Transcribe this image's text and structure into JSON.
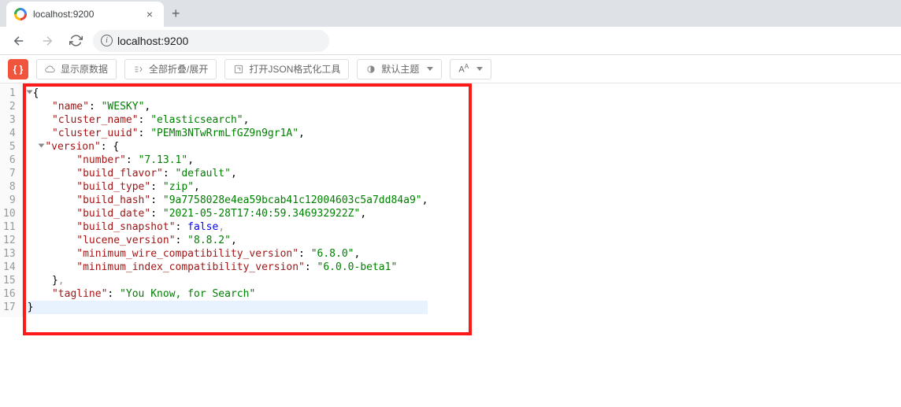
{
  "browser": {
    "tab_title": "localhost:9200",
    "url": "localhost:9200",
    "close_glyph": "×",
    "plus_glyph": "+"
  },
  "toolbar": {
    "badge": "{ }",
    "btn_raw": "显示原数据",
    "btn_collapse": "全部折叠/展开",
    "btn_open_tool": "打开JSON格式化工具",
    "btn_theme": "默认主题",
    "btn_font_base": "A",
    "btn_font_sup": "A"
  },
  "line_numbers": [
    "1",
    "2",
    "3",
    "4",
    "5",
    "6",
    "7",
    "8",
    "9",
    "10",
    "11",
    "12",
    "13",
    "14",
    "15",
    "16",
    "17"
  ],
  "json_response": {
    "name": "WESKY",
    "cluster_name": "elasticsearch",
    "cluster_uuid": "PEMm3NTwRrmLfGZ9n9gr1A",
    "version": {
      "number": "7.13.1",
      "build_flavor": "default",
      "build_type": "zip",
      "build_hash": "9a7758028e4ea59bcab41c12004603c5a7dd84a9",
      "build_date": "2021-05-28T17:40:59.346932922Z",
      "build_snapshot": "false",
      "lucene_version": "8.8.2",
      "minimum_wire_compatibility_version": "6.8.0",
      "minimum_index_compatibility_version": "6.0.0-beta1"
    },
    "tagline": "You Know, for Search"
  },
  "keys": {
    "name": "name",
    "cluster_name": "cluster_name",
    "cluster_uuid": "cluster_uuid",
    "version": "version",
    "number": "number",
    "build_flavor": "build_flavor",
    "build_type": "build_type",
    "build_hash": "build_hash",
    "build_date": "build_date",
    "build_snapshot": "build_snapshot",
    "lucene_version": "lucene_version",
    "minimum_wire_compatibility_version": "minimum_wire_compatibility_version",
    "minimum_index_compatibility_version": "minimum_index_compatibility_version",
    "tagline": "tagline"
  }
}
